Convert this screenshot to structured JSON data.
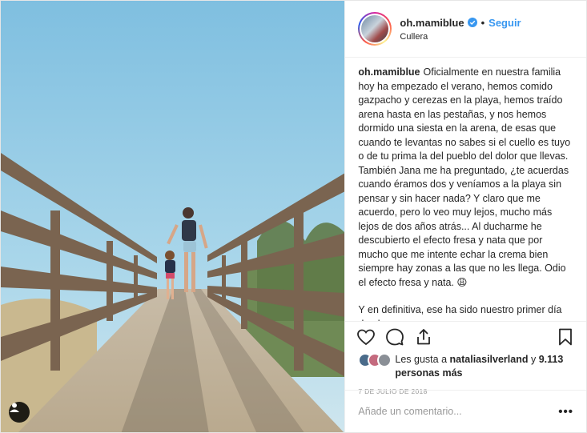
{
  "post": {
    "username": "oh.mamiblue",
    "follow_label": "Seguir",
    "separator": "•",
    "location": "Cullera",
    "caption_paragraphs": [
      "Oficialmente en nuestra familia hoy ha empezado el verano, hemos comido gazpacho y cerezas en la playa, hemos traído arena hasta en las pestañas, y nos hemos dormido una siesta en la arena, de esas que cuando te levantas no sabes si el cuello es tuyo o de tu prima la del pueblo del dolor que llevas.",
      "También Jana me ha preguntado, ¿te acuerdas cuando éramos dos y veníamos a la playa sin pensar y sin hacer nada? Y claro que me acuerdo, pero lo veo muy lejos, mucho más lejos de dos años atrás... Al ducharme he descubierto el efecto fresa y nata que por mucho que me intente echar la crema bien siempre hay zonas a las que no les llega. Odio el efecto fresa y nata. 😩",
      "Y en definitiva, ese ha sido nuestro primer día de playa"
    ],
    "likes_prefix": "Les gusta a",
    "likes_user": "nataliasilverland",
    "likes_and": "y",
    "likes_count": "9.113 personas más",
    "date": "7 DE JULIO DE 2018",
    "comment_placeholder": "Añade un comentario...",
    "more_label": "•••"
  },
  "colors": {
    "accent": "#3897f0",
    "text": "#262626",
    "muted": "#999999",
    "border": "#efefef",
    "verified": "#3897f0"
  },
  "icons": {
    "like": "heart-icon",
    "comment": "comment-icon",
    "share": "share-icon",
    "save": "bookmark-icon",
    "verified": "verified-badge-icon",
    "user_tag": "user-tag-icon"
  }
}
